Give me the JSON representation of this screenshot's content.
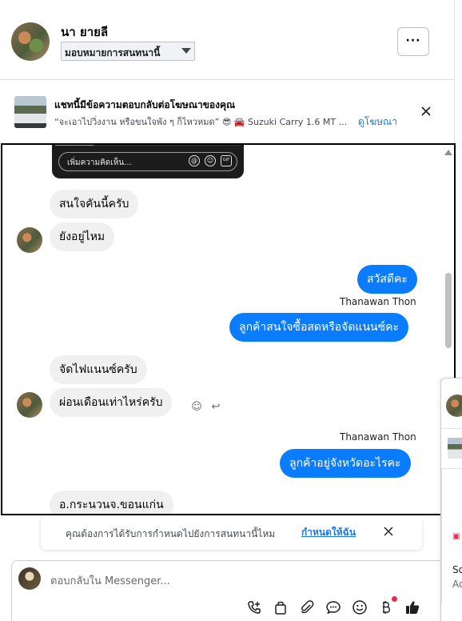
{
  "header": {
    "contact_name": "นา ยายลี",
    "assign_label": "มอบหมายการสนทนานี้",
    "more_label": "···"
  },
  "ad_banner": {
    "title": "แชทนี้มีข้อความตอบกลับต่อโฆษณาของคุณ",
    "subtitle": "“จะเอาไปวิ่งงาน หรือขนใจพัง ๆ ก็ไหวหมด” 😎 🚘 Suzuki Carry 1.6 MT ...",
    "link_label": "ดูโฆษณา"
  },
  "story_reply": {
    "placeholder": "เพิ่มความคิดเห็น...",
    "icons": [
      "at-icon",
      "emoji-icon",
      "gif-icon"
    ],
    "icon_glyphs": [
      "@",
      "☺",
      "GIF"
    ]
  },
  "messages": [
    {
      "direction": "in",
      "text": "สนใจคันนี้ครับ"
    },
    {
      "direction": "in",
      "text": "ยังอยู่ไหม"
    },
    {
      "direction": "out",
      "text": "สวัสดีคะ"
    },
    {
      "direction": "out",
      "sender": "Thanawan Thon",
      "text": "ลูกค้าสนใจซื้อสดหรือจัดแนนซ์คะ"
    },
    {
      "direction": "in",
      "text": "จัดไฟแนนซ์ครับ"
    },
    {
      "direction": "in",
      "text": "ผ่อนเดือนเท่าไหร่ครับ"
    },
    {
      "direction": "out",
      "sender": "Thanawan Thon",
      "text": "ลูกค้าอยู่จังหวัดอะไรคะ"
    },
    {
      "direction": "in",
      "text": "อ.กระนวนจ.ขอนแก่น"
    }
  ],
  "assign_prompt": {
    "question": "คุณต้องการได้รับการกำหนดไปยังการสนทนานี้ไหม",
    "link_label": "กำหนดให้ฉัน"
  },
  "composer": {
    "placeholder": "ตอบกลับใน Messenger...",
    "tools": [
      "phone-add-icon",
      "shopping-bag-icon",
      "attach-icon",
      "saved-reply-icon",
      "emoji-icon",
      "baht-payment-icon",
      "thumbs-up-icon"
    ]
  },
  "side_panel": {
    "line1": "So",
    "line2": "Ad"
  },
  "colors": {
    "outgoing_bubble": "#0a7cff",
    "incoming_bubble": "#f0f0f0",
    "link": "#1877f2",
    "notification": "#f02849"
  }
}
